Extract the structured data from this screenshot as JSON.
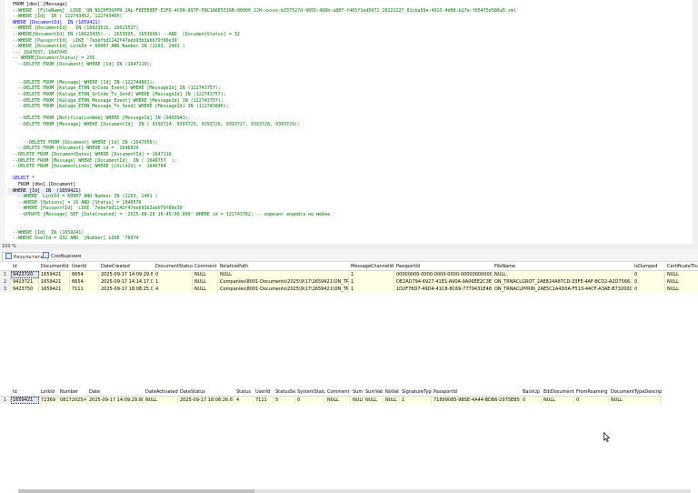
{
  "editor": {
    "lines": [
      {
        "t": "  FROM [dbo].[Message]",
        "s": ""
      },
      {
        "t": "  --WHERE  [FileName]  LIKE 'ON_NSCHFDOPPR_2AL-F8EEE8EF-E2FD-4C00-897F-F8C1A6E5316B-00000_2JH-xxxxx-b337527d-9055-488b-a887-f465f1ed5971_20221227_81cba56e-4923-4d88-b27e-f05475d586a5.xml'",
        "s": "c"
      },
      {
        "t": "  --WHERE [Id]  IN ( 122743452, 122743460)",
        "s": "c"
      },
      {
        "t": "  WHERE [DocumentId]  IN (1659421)",
        "s": "k"
      },
      {
        "t": "  --WHERE [DocumentId]   IN (16023516, 16023517)",
        "s": "c"
      },
      {
        "t": "  --WHERE[DocumentId] IN (16023435)--, 1653695, 1653696) --AND  [DocumentStatus] = 32",
        "s": "c"
      },
      {
        "t": "  --WHERE [PassportId]  LIKE '7ebefbd1142f47eeb93b3abb79f86e30'",
        "s": "c"
      },
      {
        "t": "  --WHERE [DocumentId] LinkId = 60007 AND Number IN (2263, 2401 )",
        "s": "c"
      },
      {
        "t": "  --- 1647037, 1647045",
        "s": "c"
      },
      {
        "t": "  -- WHERE[DocumentStatus] = 256",
        "s": "c"
      },
      {
        "t": "    --DELETE FROM [Document] WHERE [Id] IN (1647110);",
        "s": "c"
      },
      {
        "t": "",
        "s": ""
      },
      {
        "t": "",
        "s": ""
      },
      {
        "t": "    --DELETE FROM [Message] WHERE [Id] IN (122744861);",
        "s": "c"
      },
      {
        "t": "    --DELETE FROM [Kaluga_ETRN_QrCode_Event] WHERE [MessageId] IN (122743757);",
        "s": "c"
      },
      {
        "t": "    --DELETE FROM [Kaluga_ETRN_QrCode_To_Send] WHERE [MessageId] IN (122743757);",
        "s": "c"
      },
      {
        "t": "    --DELETE FROM [Kaluga_ETRN_Message_Event] WHERE [MessageId] IN (122743757);",
        "s": "c"
      },
      {
        "t": "    --DELETE FROM [Kaluga_ETRN_Message_To_Send] WHERE [MessageId] IN (122743846);",
        "s": "c"
      },
      {
        "t": "",
        "s": ""
      },
      {
        "t": "    --DELETE FROM [NotificationWeb] WHERE [MessageId] IN (9403941);",
        "s": "c"
      },
      {
        "t": "    --DELETE FROM [Message] WHERE [DocumentId]  IN ( 9393724, 9393725, 9393726, 9393727, 9393728, 9393729);",
        "s": "c"
      },
      {
        "t": "",
        "s": ""
      },
      {
        "t": "",
        "s": ""
      },
      {
        "t": "      --DELETE FROM [Document] WHERE [Id] IN (1647056);",
        "s": "c"
      },
      {
        "t": "    --DELETE FROM [Document] WHERE id =  1646839",
        "s": "c"
      },
      {
        "t": "  --DELETE FROM [DocumentDates] WHERE [DocumentId] = 1647110",
        "s": "c"
      },
      {
        "t": "  --DELETE FROM [Message] WHERE [DocumentId]  IN ( 1646757  );",
        "s": "c"
      },
      {
        "t": "  --DELETE FROM [DocumentLinks] WHERE [ChildId] =  1646764",
        "s": "c"
      },
      {
        "t": "",
        "s": ""
      },
      {
        "t": "  SELECT *",
        "s": "k"
      },
      {
        "t": "    FROM [dbo].[Document]",
        "s": ""
      },
      {
        "t": "  WHERE [Id]  IN  (1659421)",
        "s": "sel"
      },
      {
        "t": "    --WHERE  LinkId = 60007 AND Number IN (2263, 2401 )",
        "s": "c"
      },
      {
        "t": "    --WHERE [Options] = 16 AND [Status] = 1040576",
        "s": "c"
      },
      {
        "t": "    --WHERE [PassportId]  LIKE '7ebefbd1142f47eeb93b3abb79f86e30'",
        "s": "c"
      },
      {
        "t": "    --UPDATE [Message] SET [DateCreated] = '2025-08-28 16:45:00.000' WHERE id = 122743762; -- варкант апдейта не мейне",
        "s": "c"
      },
      {
        "t": "",
        "s": ""
      },
      {
        "t": "",
        "s": ""
      },
      {
        "t": "  --WHERE [Id]  IN (1659241)",
        "s": "c"
      },
      {
        "t": "  --WHERE UserId = 332 AND  [Number] LIKE '78974'",
        "s": "c"
      }
    ]
  },
  "zoom": "100 %",
  "tabs": {
    "results": "Результаты",
    "messages": "Сообщения"
  },
  "grid1": {
    "columns": [
      "Id",
      "DocumentId",
      "UserId",
      "DateCreated",
      "DocumentStatus",
      "Comment",
      "RelativePath",
      "MessageChannelId",
      "PassportId",
      "FileName",
      "IsDumped",
      "CertificateThumbprint"
    ],
    "rows": [
      [
        "1",
        "9423720",
        "1659421",
        "6654",
        "2025-09-17 14:09:29.880",
        "0",
        "NULL",
        "NULL",
        "1",
        "00000000-0000-0000-0000-000000000000",
        "NULL",
        "0",
        "NULL"
      ],
      [
        "2",
        "9423721",
        "1659421",
        "6654",
        "2025-09-17 14:14:17.000",
        "1",
        "NULL",
        "Companies\\8001-Documents\\2025\\9\\17\\1659421\\ON_TR...",
        "1",
        "DE2AD794-6927-41E1-A90A-9A06EE2C3ED1",
        "ON_TRNACLGROT_2AE824A87CD-33FE-4AF-BCD2-A2D7566...",
        "0",
        "NULL"
      ],
      [
        "3",
        "9423750",
        "1659421",
        "7111",
        "2025-09-17 18:08:25.000",
        "4",
        "NULL",
        "Companies\\8001-Documents\\2025\\9\\17\\1659421\\ON_TR...",
        "1",
        "1D2F78D7-49D4-41C8-8C69-7779431E4814",
        "ON_TRNACLPPRIN_2AE5C1A4D0A-F513-44CF-A3AE-B73200D...",
        "0",
        "NULL"
      ]
    ]
  },
  "grid2": {
    "columns": [
      "Id",
      "LinkId",
      "Number",
      "Date",
      "DateActivated",
      "DateStatus",
      "Status",
      "UserId",
      "StatusSet",
      "SystemStatus",
      "Comment",
      "Sum",
      "SumVat",
      "NoVat",
      "SignatureType",
      "PassportId",
      "BackUp",
      "EdiDocumentId",
      "FromRoaming",
      "DocumentTypeDescription"
    ],
    "rows": [
      [
        "1",
        "1659421",
        "72369",
        "08172025/4",
        "2025-09-17 14:09:29.880",
        "NULL",
        "2025-09-17 18:08:26.670",
        "4",
        "7111",
        "5",
        "0",
        "NULL",
        "NULL",
        "NULL",
        "NULL",
        "1",
        "71899085-9B5E-4A44-BDB6-2975EB5406D7",
        "0",
        "NULL",
        "0",
        "NULL"
      ]
    ]
  }
}
